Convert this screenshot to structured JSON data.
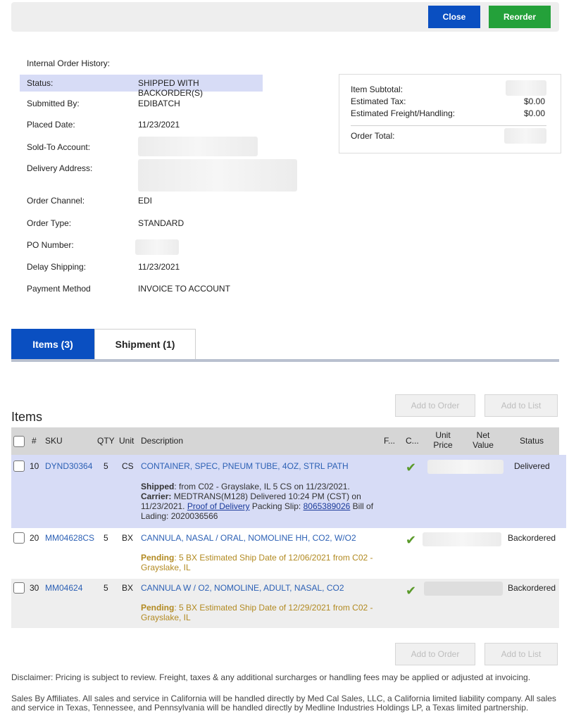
{
  "toolbar": {
    "close_label": "Close",
    "reorder_label": "Reorder"
  },
  "order": {
    "history_title": "Internal Order History:",
    "fields": [
      {
        "label": "Status:",
        "value": "SHIPPED WITH BACKORDER(S)"
      },
      {
        "label": "Submitted By:",
        "value": "EDIBATCH"
      },
      {
        "label": "Placed Date:",
        "value": "11/23/2021"
      },
      {
        "label": "Sold-To Account:",
        "value": ""
      },
      {
        "label": "Delivery Address:",
        "value": ""
      },
      {
        "label": "Order Channel:",
        "value": "EDI"
      },
      {
        "label": "Order Type:",
        "value": "STANDARD"
      },
      {
        "label": "PO Number:",
        "value": ""
      },
      {
        "label": "Delay Shipping:",
        "value": "11/23/2021"
      },
      {
        "label": "Payment Method",
        "value": "INVOICE TO ACCOUNT"
      }
    ]
  },
  "summary": {
    "item_subtotal_label": "Item Subtotal:",
    "est_tax_label": "Estimated Tax:",
    "est_tax_value": "$0.00",
    "est_freight_label": "Estimated Freight/Handling:",
    "est_freight_value": "$0.00",
    "order_total_label": "Order Total:"
  },
  "tabs": [
    {
      "label": "Items (3)"
    },
    {
      "label": "Shipment (1)"
    }
  ],
  "items": {
    "title": "Items",
    "add_to_order_label": "Add to Order",
    "add_to_list_label": "Add to List",
    "columns": {
      "num": "#",
      "sku": "SKU",
      "qty": "QTY",
      "unit": "Unit",
      "description": "Description",
      "f": "F...",
      "c": "C...",
      "unit_price": "Unit Price",
      "net_value": "Net Value",
      "status": "Status"
    },
    "rows": [
      {
        "num": "10",
        "sku": "DYND30364",
        "qty": "5",
        "unit": "CS",
        "description": "CONTAINER, SPEC, PNEUM TUBE, 4OZ, STRL PATH",
        "status": "Delivered",
        "shipped_label": "Shipped",
        "shipped_text": ": from C02 - Grayslake, IL 5 CS on 11/23/2021.",
        "carrier_label": "Carrier:",
        "carrier_text": " MEDTRANS(M128) Delivered 10:24 PM (CST) on 11/23/2021. ",
        "pod_link": " Proof of Delivery",
        "packing_text": " Packing Slip: ",
        "packing_link": "8065389026",
        "bol_text": " Bill of Lading: 2020036566"
      },
      {
        "num": "20",
        "sku": "MM04628CS",
        "qty": "5",
        "unit": "BX",
        "description": "CANNULA, NASAL / ORAL, NOMOLINE HH, CO2, W/O2",
        "status": "Backordered",
        "pending_label": "Pending",
        "pending_text": ": 5 BX Estimated Ship Date of 12/06/2021 from C02 - Grayslake, IL"
      },
      {
        "num": "30",
        "sku": "MM04624",
        "qty": "5",
        "unit": "BX",
        "description": "CANNULA W / O2, NOMOLINE, ADULT, NASAL, CO2",
        "status": "Backordered",
        "pending_label": "Pending",
        "pending_text": ": 5 BX Estimated Ship Date of 12/29/2021 from C02 - Grayslake, IL"
      }
    ]
  },
  "disclaimer": "Disclaimer: Pricing is subject to review. Freight, taxes & any additional surcharges or handling fees may be applied or adjusted at invoicing.",
  "affiliates": "Sales By Affiliates. All sales and service in California will be handled directly by Med Cal Sales, LLC, a California limited liability company. All sales and service in Texas, Tennessee, and Pennsylvania will be handled directly by Medline Industries Holdings LP, a Texas limited partnership.",
  "colors": {
    "primary": "#0a4fc1",
    "success": "#24a13a",
    "highlight": "#d7dcf6",
    "link": "#2d61b5",
    "pending": "#b28a21"
  }
}
